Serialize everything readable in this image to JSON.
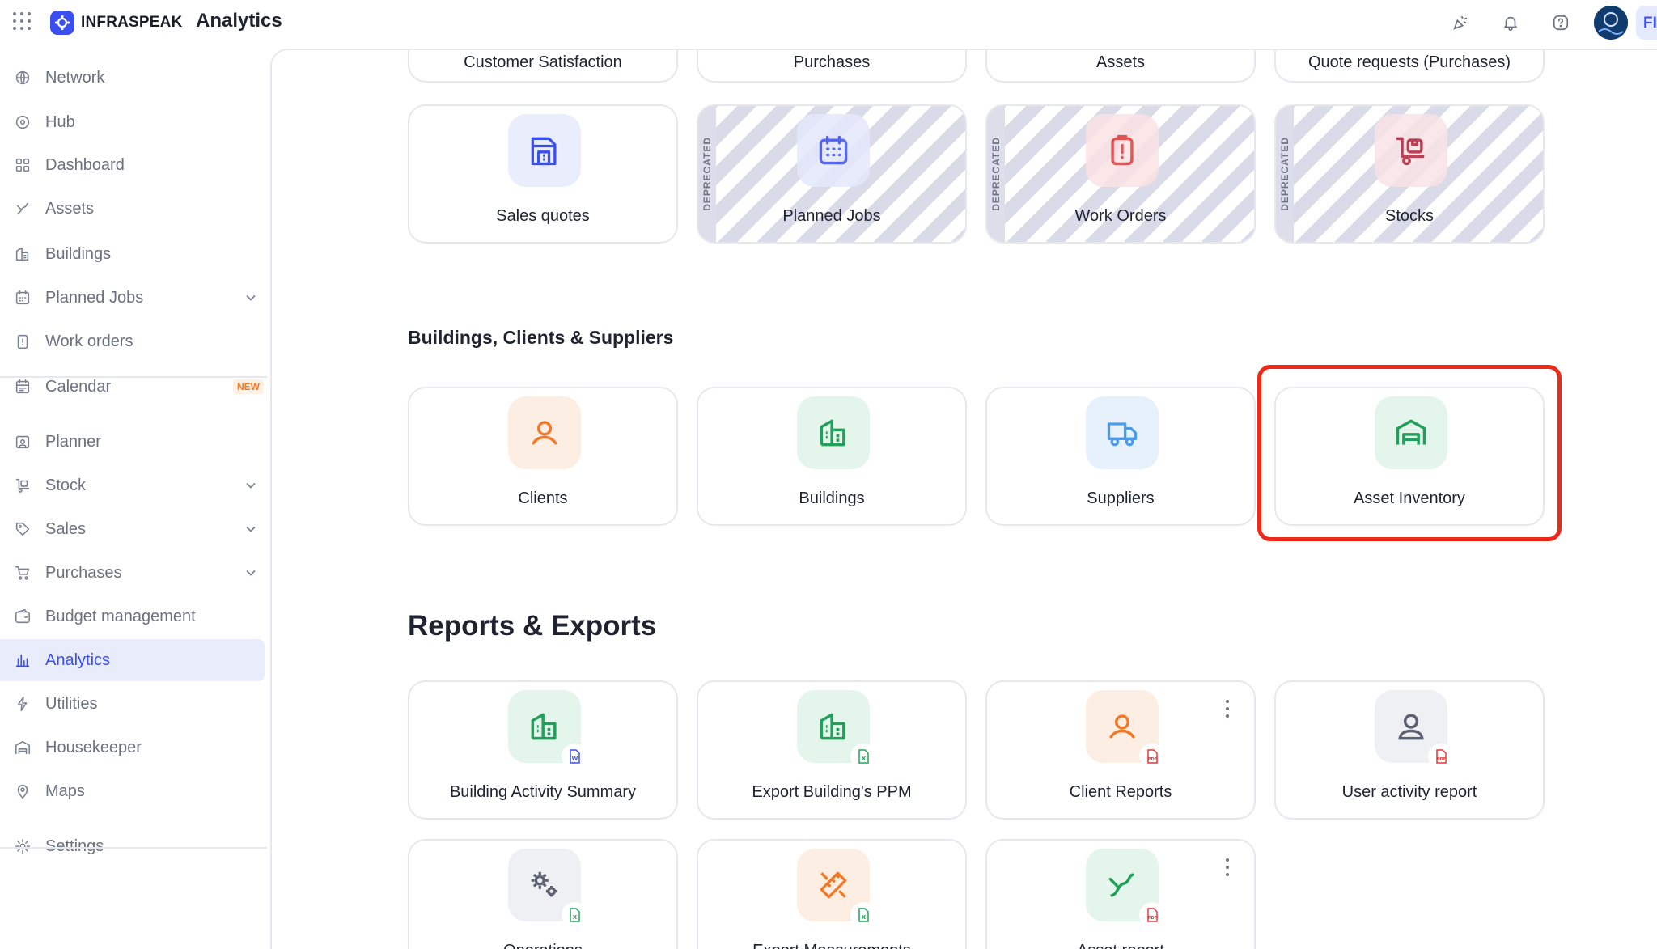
{
  "app": {
    "brand": "INFRASPEAK",
    "title": "Analytics",
    "user_initials": "FI"
  },
  "sidebar": {
    "items": [
      {
        "label": "Network",
        "icon": "network-icon"
      },
      {
        "label": "Hub",
        "icon": "hub-icon"
      },
      {
        "label": "Dashboard",
        "icon": "dashboard-icon"
      },
      {
        "label": "Assets",
        "icon": "assets-icon"
      },
      {
        "label": "Buildings",
        "icon": "buildings-icon"
      },
      {
        "label": "Planned Jobs",
        "icon": "calendar-grid-icon"
      },
      {
        "label": "Work orders",
        "icon": "clipboard-icon"
      },
      {
        "label": "Calendar",
        "icon": "calendar-icon",
        "badge": "NEW"
      },
      {
        "label": "Planner",
        "icon": "planner-icon"
      },
      {
        "label": "Stock",
        "icon": "stock-icon"
      },
      {
        "label": "Sales",
        "icon": "tag-icon"
      },
      {
        "label": "Purchases",
        "icon": "cart-icon"
      },
      {
        "label": "Budget management",
        "icon": "wallet-icon"
      },
      {
        "label": "Analytics",
        "icon": "bar-chart-icon"
      },
      {
        "label": "Utilities",
        "icon": "bolt-icon"
      },
      {
        "label": "Housekeeper",
        "icon": "housekeeper-icon"
      },
      {
        "label": "Maps",
        "icon": "map-pin-icon"
      },
      {
        "label": "Settings",
        "icon": "gear-icon"
      }
    ]
  },
  "cards_top_row": [
    "Customer Satisfaction",
    "Purchases",
    "Assets",
    "Quote requests (Purchases)"
  ],
  "cards_row2": [
    {
      "label": "Sales quotes"
    },
    {
      "label": "Planned Jobs",
      "tag": "DEPRECATED"
    },
    {
      "label": "Work Orders",
      "tag": "DEPRECATED"
    },
    {
      "label": "Stocks",
      "tag": "DEPRECATED"
    }
  ],
  "section_buildings": {
    "title": "Buildings, Clients & Suppliers",
    "cards": [
      "Clients",
      "Buildings",
      "Suppliers",
      "Asset Inventory"
    ]
  },
  "section_reports": {
    "title": "Reports & Exports",
    "cards": [
      "Building Activity Summary",
      "Export Building's PPM",
      "Client Reports",
      "User activity report"
    ],
    "cards_row2": [
      "Operations",
      "Export Measurements",
      "Asset report"
    ]
  },
  "colors": {
    "accent": "#3b4ff0",
    "highlight": "#ec2a1a",
    "green": "#22a05b",
    "orange": "#f07a2a",
    "red": "#e23b3b",
    "light_blue": "#4a9be8"
  }
}
